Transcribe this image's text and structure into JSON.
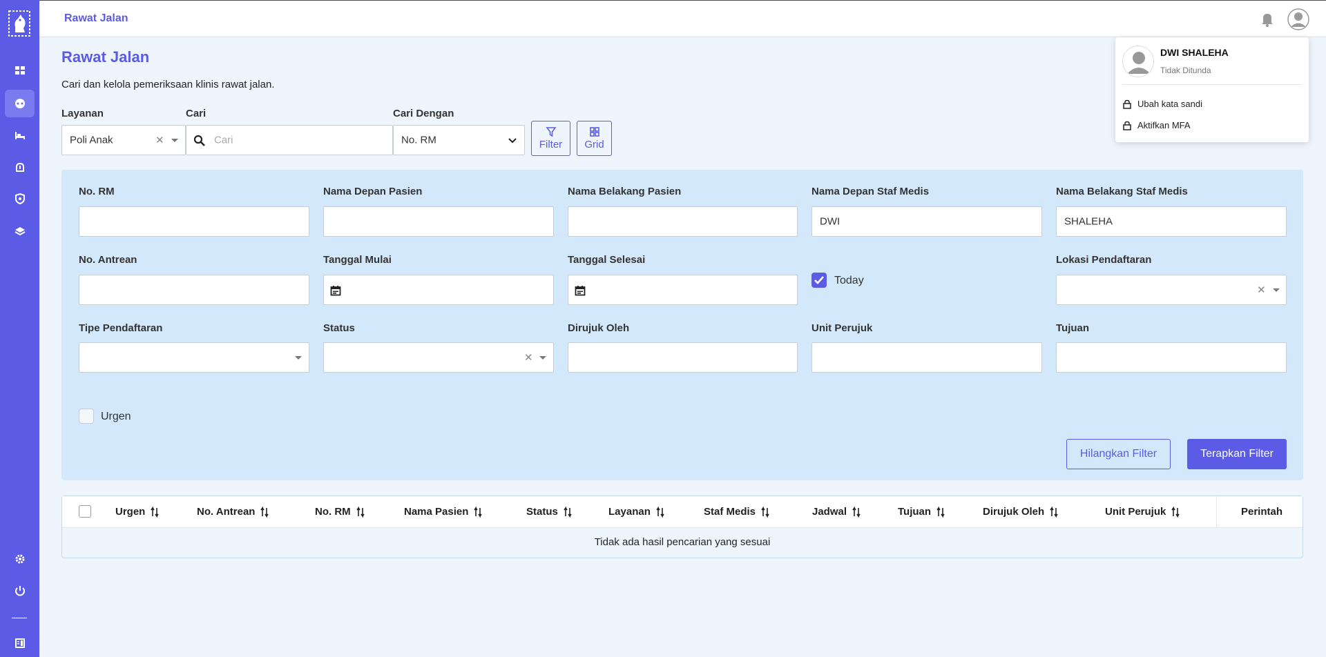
{
  "topbar": {
    "title": "Rawat Jalan"
  },
  "page": {
    "title": "Rawat Jalan",
    "description": "Cari dan kelola pemeriksaan klinis rawat jalan."
  },
  "search": {
    "layanan_label": "Layanan",
    "layanan_value": "Poli Anak",
    "cari_label": "Cari",
    "cari_placeholder": "Cari",
    "cari_dengan_label": "Cari Dengan",
    "cari_dengan_value": "No. RM",
    "filter_label": "Filter",
    "grid_label": "Grid"
  },
  "filters": {
    "no_rm": "No. RM",
    "nama_depan_pasien": "Nama Depan Pasien",
    "nama_belakang_pasien": "Nama Belakang Pasien",
    "nama_depan_staf": "Nama Depan Staf Medis",
    "nama_depan_staf_value": "DWI",
    "nama_belakang_staf": "Nama Belakang Staf Medis",
    "nama_belakang_staf_value": "SHALEHA",
    "no_antrean": "No. Antrean",
    "tanggal_mulai": "Tanggal Mulai",
    "tanggal_selesai": "Tanggal Selesai",
    "today": "Today",
    "lokasi_pendaftaran": "Lokasi Pendaftaran",
    "tipe_pendaftaran": "Tipe Pendaftaran",
    "status": "Status",
    "dirujuk_oleh": "Dirujuk Oleh",
    "unit_perujuk": "Unit Perujuk",
    "tujuan": "Tujuan",
    "urgen": "Urgen",
    "clear_button": "Hilangkan Filter",
    "apply_button": "Terapkan Filter"
  },
  "table": {
    "columns": [
      "Urgen",
      "No. Antrean",
      "No. RM",
      "Nama Pasien",
      "Status",
      "Layanan",
      "Staf Medis",
      "Jadwal",
      "Tujuan",
      "Dirujuk Oleh",
      "Unit Perujuk",
      "Perintah"
    ],
    "empty_message": "Tidak ada hasil pencarian yang sesuai"
  },
  "user_menu": {
    "name": "DWI SHALEHA",
    "status": "Tidak Ditunda",
    "items": [
      "Ubah kata sandi",
      "Aktifkan MFA"
    ]
  },
  "colors": {
    "primary": "#5b5be6",
    "panel": "#d3e8fb",
    "background": "#eef5fc"
  }
}
